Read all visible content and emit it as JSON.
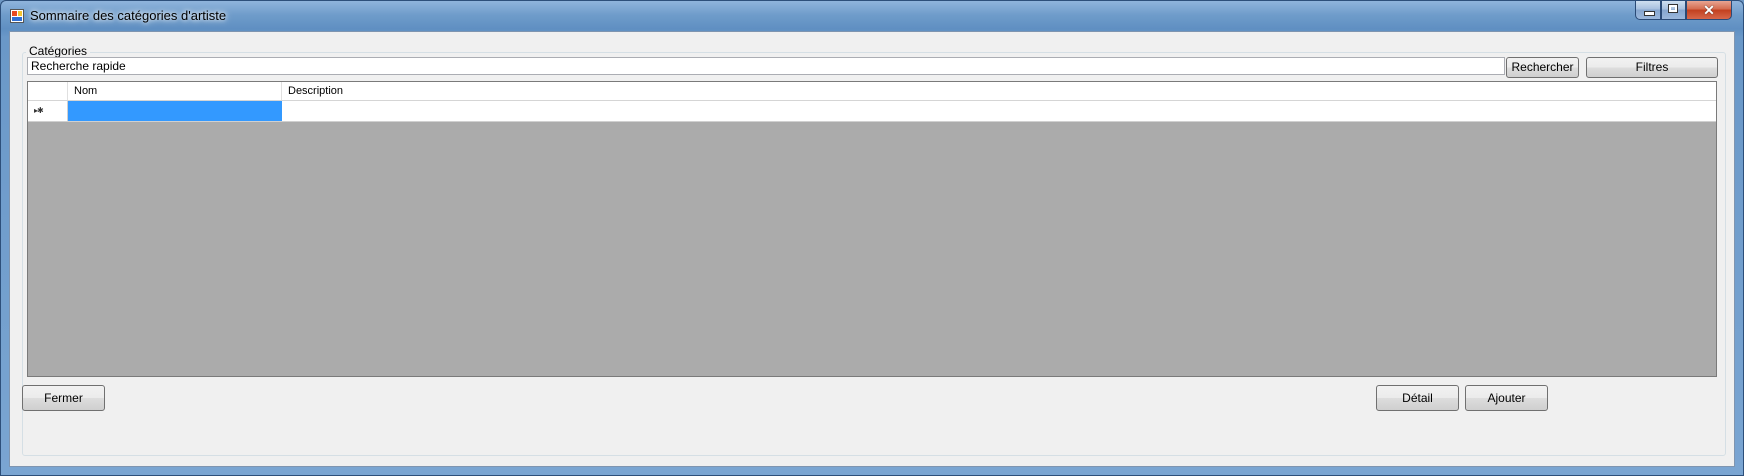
{
  "window": {
    "title": "Sommaire des catégories d'artiste",
    "controls": {
      "close_glyph": "✕"
    }
  },
  "group": {
    "label": "Catégories"
  },
  "search": {
    "value": "Recherche rapide"
  },
  "buttons": {
    "search": "Rechercher",
    "filters": "Filtres",
    "close": "Fermer",
    "detail": "Détail",
    "add": "Ajouter"
  },
  "grid": {
    "columns": [
      "Nom",
      "Description"
    ],
    "new_row_marker": "▸✱",
    "rows": [
      {
        "nom": "",
        "description": ""
      }
    ]
  },
  "colors": {
    "selection": "#3399ff",
    "grid_background": "#ababab",
    "title_bar": "#6f9cca"
  }
}
